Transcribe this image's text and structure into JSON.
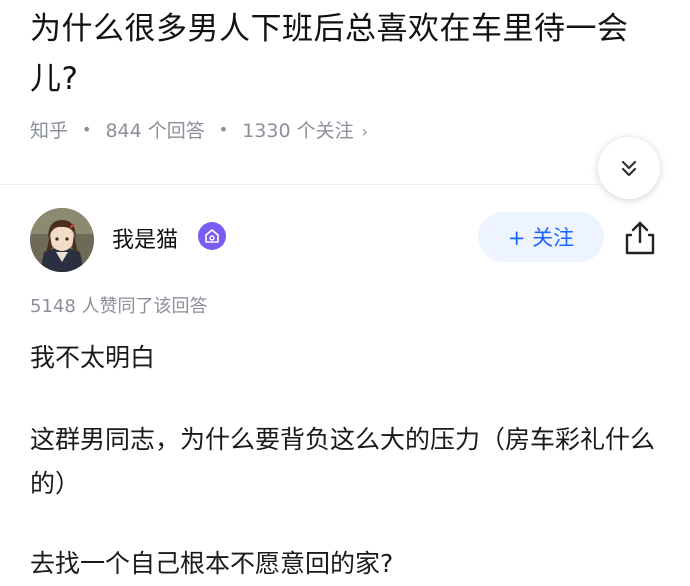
{
  "question": {
    "title": "为什么很多男人下班后总喜欢在车里待一会儿?"
  },
  "meta": {
    "source": "知乎",
    "answers": "844 个回答",
    "followers": "1330 个关注",
    "chevron": "›"
  },
  "icons": {
    "expand": "chevrons-down-icon",
    "share": "share-icon",
    "badge": "verified-badge-icon"
  },
  "colors": {
    "accent": "#1966ff",
    "follow_bg": "#eef4ff",
    "badge": "#7b5cf0",
    "muted": "#8a8f99"
  },
  "author": {
    "name": "我是猫",
    "follow_label": "+ 关注"
  },
  "answer": {
    "votes": "5148 人赞同了该回答",
    "paragraphs": [
      "我不太明白",
      "这群男同志，为什么要背负这么大的压力（房车彩礼什么的）",
      "去找一个自己根本不愿意回的家?"
    ]
  }
}
